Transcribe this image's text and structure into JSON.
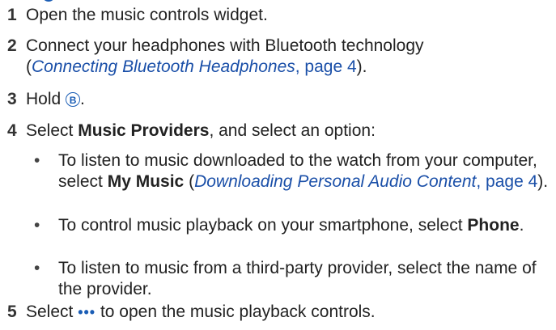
{
  "steps": [
    {
      "num": "1",
      "text": "Open the music controls widget."
    },
    {
      "num": "2",
      "text_a": "Connect your headphones with Bluetooth technology",
      "open_paren": "(",
      "link_title": "Connecting Bluetooth Headphones",
      "link_page": ", page 4",
      "close": ")."
    },
    {
      "num": "3",
      "pre": "Hold ",
      "button": "B",
      "post": "."
    },
    {
      "num": "4",
      "pre": "Select ",
      "bold": "Music Providers",
      "post": ", and select an option:"
    },
    {
      "num": "5",
      "pre": "Select ",
      "dots": "•••",
      "post": " to open the music playback controls."
    }
  ],
  "options": [
    {
      "bullet": "•",
      "pre": "To listen to music downloaded to the watch from your computer, select ",
      "bold": "My Music",
      "mid": " (",
      "link_title": "Downloading Personal Audio Content",
      "link_page": ", page 4",
      "post": ")."
    },
    {
      "bullet": "•",
      "pre": "To control music playback on your smartphone, select ",
      "bold": "Phone",
      "post": "."
    },
    {
      "bullet": "•",
      "text": "To listen to music from a third-party provider, select the name of the provider."
    }
  ],
  "colors": {
    "link": "#1a4fa8",
    "icon": "#1a5db5"
  }
}
